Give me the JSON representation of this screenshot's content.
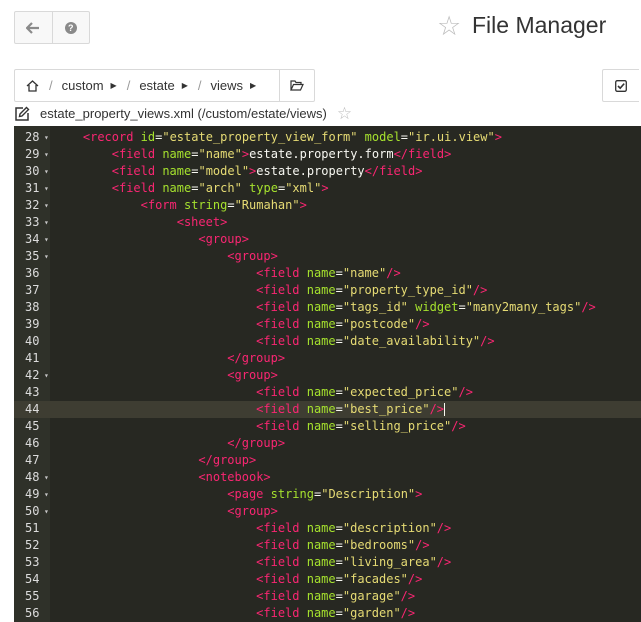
{
  "header": {
    "title": "File Manager",
    "back_icon": "arrow-left-icon",
    "help_icon": "question-circle-icon"
  },
  "breadcrumb": {
    "home_icon": "home-icon",
    "items": [
      "custom",
      "estate",
      "views"
    ],
    "separator": "/",
    "folder_icon": "folder-open-icon"
  },
  "toolbar": {
    "check_icon": "check-square-icon"
  },
  "file": {
    "name": "estate_property_views.xml (/custom/estate/views)",
    "edit_icon": "edit-icon"
  },
  "editor": {
    "theme_colors": {
      "bg": "#272822",
      "tag": "#f92672",
      "attr": "#a6e22e",
      "string": "#e6db74",
      "text": "#f8f8f2"
    },
    "active_line": 44,
    "lines": [
      {
        "n": "28",
        "fold": true,
        "indent": 4,
        "tokens": [
          [
            "t",
            "<record "
          ],
          [
            "a",
            "id"
          ],
          [
            "x",
            "="
          ],
          [
            "s",
            "\"estate_property_view_form\""
          ],
          [
            "x",
            " "
          ],
          [
            "a",
            "model"
          ],
          [
            "x",
            "="
          ],
          [
            "s",
            "\"ir.ui.view\""
          ],
          [
            "t",
            ">"
          ]
        ]
      },
      {
        "n": "29",
        "fold": true,
        "indent": 8,
        "tokens": [
          [
            "t",
            "<field "
          ],
          [
            "a",
            "name"
          ],
          [
            "x",
            "="
          ],
          [
            "s",
            "\"name\""
          ],
          [
            "t",
            ">"
          ],
          [
            "x",
            "estate.property.form"
          ],
          [
            "t",
            "</field>"
          ]
        ]
      },
      {
        "n": "30",
        "fold": true,
        "indent": 8,
        "tokens": [
          [
            "t",
            "<field "
          ],
          [
            "a",
            "name"
          ],
          [
            "x",
            "="
          ],
          [
            "s",
            "\"model\""
          ],
          [
            "t",
            ">"
          ],
          [
            "x",
            "estate.property"
          ],
          [
            "t",
            "</field>"
          ]
        ]
      },
      {
        "n": "31",
        "fold": true,
        "indent": 8,
        "tokens": [
          [
            "t",
            "<field "
          ],
          [
            "a",
            "name"
          ],
          [
            "x",
            "="
          ],
          [
            "s",
            "\"arch\""
          ],
          [
            "x",
            " "
          ],
          [
            "a",
            "type"
          ],
          [
            "x",
            "="
          ],
          [
            "s",
            "\"xml\""
          ],
          [
            "t",
            ">"
          ]
        ]
      },
      {
        "n": "32",
        "fold": true,
        "indent": 12,
        "tokens": [
          [
            "t",
            "<form "
          ],
          [
            "a",
            "string"
          ],
          [
            "x",
            "="
          ],
          [
            "s",
            "\"Rumahan\""
          ],
          [
            "t",
            ">"
          ]
        ]
      },
      {
        "n": "33",
        "fold": true,
        "indent": 17,
        "tokens": [
          [
            "t",
            "<sheet>"
          ]
        ]
      },
      {
        "n": "34",
        "fold": true,
        "indent": 20,
        "tokens": [
          [
            "t",
            "<group>"
          ]
        ]
      },
      {
        "n": "35",
        "fold": true,
        "indent": 24,
        "tokens": [
          [
            "t",
            "<group>"
          ]
        ]
      },
      {
        "n": "36",
        "fold": false,
        "indent": 28,
        "tokens": [
          [
            "t",
            "<field "
          ],
          [
            "a",
            "name"
          ],
          [
            "x",
            "="
          ],
          [
            "s",
            "\"name\""
          ],
          [
            "t",
            "/>"
          ]
        ]
      },
      {
        "n": "37",
        "fold": false,
        "indent": 28,
        "tokens": [
          [
            "t",
            "<field "
          ],
          [
            "a",
            "name"
          ],
          [
            "x",
            "="
          ],
          [
            "s",
            "\"property_type_id\""
          ],
          [
            "t",
            "/>"
          ]
        ]
      },
      {
        "n": "38",
        "fold": false,
        "indent": 28,
        "tokens": [
          [
            "t",
            "<field "
          ],
          [
            "a",
            "name"
          ],
          [
            "x",
            "="
          ],
          [
            "s",
            "\"tags_id\""
          ],
          [
            "x",
            " "
          ],
          [
            "a",
            "widget"
          ],
          [
            "x",
            "="
          ],
          [
            "s",
            "\"many2many_tags\""
          ],
          [
            "t",
            "/>"
          ]
        ]
      },
      {
        "n": "39",
        "fold": false,
        "indent": 28,
        "tokens": [
          [
            "t",
            "<field "
          ],
          [
            "a",
            "name"
          ],
          [
            "x",
            "="
          ],
          [
            "s",
            "\"postcode\""
          ],
          [
            "t",
            "/>"
          ]
        ]
      },
      {
        "n": "40",
        "fold": false,
        "indent": 28,
        "tokens": [
          [
            "t",
            "<field "
          ],
          [
            "a",
            "name"
          ],
          [
            "x",
            "="
          ],
          [
            "s",
            "\"date_availability\""
          ],
          [
            "t",
            "/>"
          ]
        ]
      },
      {
        "n": "41",
        "fold": false,
        "indent": 24,
        "tokens": [
          [
            "t",
            "</group>"
          ]
        ]
      },
      {
        "n": "42",
        "fold": true,
        "indent": 24,
        "tokens": [
          [
            "t",
            "<group>"
          ]
        ]
      },
      {
        "n": "43",
        "fold": false,
        "indent": 28,
        "tokens": [
          [
            "t",
            "<field "
          ],
          [
            "a",
            "name"
          ],
          [
            "x",
            "="
          ],
          [
            "s",
            "\"expected_price\""
          ],
          [
            "t",
            "/>"
          ]
        ]
      },
      {
        "n": "44",
        "fold": false,
        "indent": 28,
        "tokens": [
          [
            "t",
            "<field "
          ],
          [
            "a",
            "name"
          ],
          [
            "x",
            "="
          ],
          [
            "s",
            "\"best_price\""
          ],
          [
            "t",
            "/>"
          ]
        ]
      },
      {
        "n": "45",
        "fold": false,
        "indent": 28,
        "tokens": [
          [
            "t",
            "<field "
          ],
          [
            "a",
            "name"
          ],
          [
            "x",
            "="
          ],
          [
            "s",
            "\"selling_price\""
          ],
          [
            "t",
            "/>"
          ]
        ]
      },
      {
        "n": "46",
        "fold": false,
        "indent": 24,
        "tokens": [
          [
            "t",
            "</group>"
          ]
        ]
      },
      {
        "n": "47",
        "fold": false,
        "indent": 20,
        "tokens": [
          [
            "t",
            "</group>"
          ]
        ]
      },
      {
        "n": "48",
        "fold": true,
        "indent": 20,
        "tokens": [
          [
            "t",
            "<notebook>"
          ]
        ]
      },
      {
        "n": "49",
        "fold": true,
        "indent": 24,
        "tokens": [
          [
            "t",
            "<page "
          ],
          [
            "a",
            "string"
          ],
          [
            "x",
            "="
          ],
          [
            "s",
            "\"Description\""
          ],
          [
            "t",
            ">"
          ]
        ]
      },
      {
        "n": "50",
        "fold": true,
        "indent": 24,
        "tokens": [
          [
            "t",
            "<group>"
          ]
        ]
      },
      {
        "n": "51",
        "fold": false,
        "indent": 28,
        "tokens": [
          [
            "t",
            "<field "
          ],
          [
            "a",
            "name"
          ],
          [
            "x",
            "="
          ],
          [
            "s",
            "\"description\""
          ],
          [
            "t",
            "/>"
          ]
        ]
      },
      {
        "n": "52",
        "fold": false,
        "indent": 28,
        "tokens": [
          [
            "t",
            "<field "
          ],
          [
            "a",
            "name"
          ],
          [
            "x",
            "="
          ],
          [
            "s",
            "\"bedrooms\""
          ],
          [
            "t",
            "/>"
          ]
        ]
      },
      {
        "n": "53",
        "fold": false,
        "indent": 28,
        "tokens": [
          [
            "t",
            "<field "
          ],
          [
            "a",
            "name"
          ],
          [
            "x",
            "="
          ],
          [
            "s",
            "\"living_area\""
          ],
          [
            "t",
            "/>"
          ]
        ]
      },
      {
        "n": "54",
        "fold": false,
        "indent": 28,
        "tokens": [
          [
            "t",
            "<field "
          ],
          [
            "a",
            "name"
          ],
          [
            "x",
            "="
          ],
          [
            "s",
            "\"facades\""
          ],
          [
            "t",
            "/>"
          ]
        ]
      },
      {
        "n": "55",
        "fold": false,
        "indent": 28,
        "tokens": [
          [
            "t",
            "<field "
          ],
          [
            "a",
            "name"
          ],
          [
            "x",
            "="
          ],
          [
            "s",
            "\"garage\""
          ],
          [
            "t",
            "/>"
          ]
        ]
      },
      {
        "n": "56",
        "fold": false,
        "indent": 28,
        "tokens": [
          [
            "t",
            "<field "
          ],
          [
            "a",
            "name"
          ],
          [
            "x",
            "="
          ],
          [
            "s",
            "\"garden\""
          ],
          [
            "t",
            "/>"
          ]
        ]
      }
    ]
  }
}
